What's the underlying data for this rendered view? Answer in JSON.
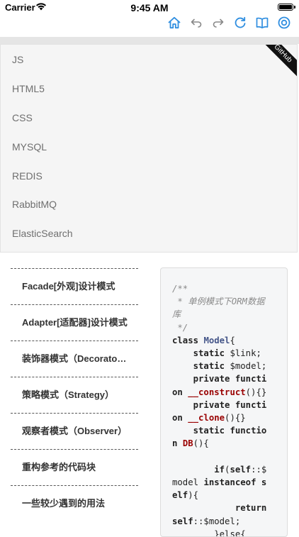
{
  "status_bar": {
    "carrier": "Carrier",
    "time": "9:45 AM"
  },
  "toolbar": {
    "icons": [
      "home-icon",
      "back-icon",
      "forward-icon",
      "refresh-icon",
      "book-icon",
      "settings-icon"
    ],
    "accent_color": "#2f8ee0"
  },
  "ribbon": {
    "text": "GitHub"
  },
  "menu": {
    "items": [
      "JS",
      "HTML5",
      "CSS",
      "MYSQL",
      "REDIS",
      "RabbitMQ",
      "ElasticSearch"
    ]
  },
  "toc": {
    "items": [
      "Facade[外观]设计模式",
      "Adapter[适配器]设计模式",
      "装饰器模式（Decorator）",
      "策略模式（Strategy）",
      "观察者模式（Observer）",
      "重构参考的代码块",
      "一些较少遇到的用法"
    ]
  },
  "code": {
    "comment_open": "/**",
    "comment_line1": " * 单例模式下ORM数据",
    "comment_line2": "库",
    "comment_close": " */",
    "class_kw": "class",
    "class_name": "Model",
    "brace_open": "{",
    "static_kw": "static",
    "link_var": "$link;",
    "model_var": "$model;",
    "private_kw": "private",
    "functi_part": "functi",
    "on_part": "on",
    "construct_fn": "__construct",
    "parens_braces": "(){}",
    "clone_fn": "__clone",
    "function_kw": "functio",
    "n_part": "n",
    "db_fn": "DB",
    "db_tail": "(){",
    "if_kw": "if",
    "self_kw": "self",
    "self_model": "::$",
    "model_word": "model",
    "instanceof_kw": "instanceof",
    "s_part": "s",
    "elf_part": "elf",
    "elf_tail": "){",
    "return_kw": "return",
    "return_tail": "::$model;",
    "else_line": "}else{"
  }
}
